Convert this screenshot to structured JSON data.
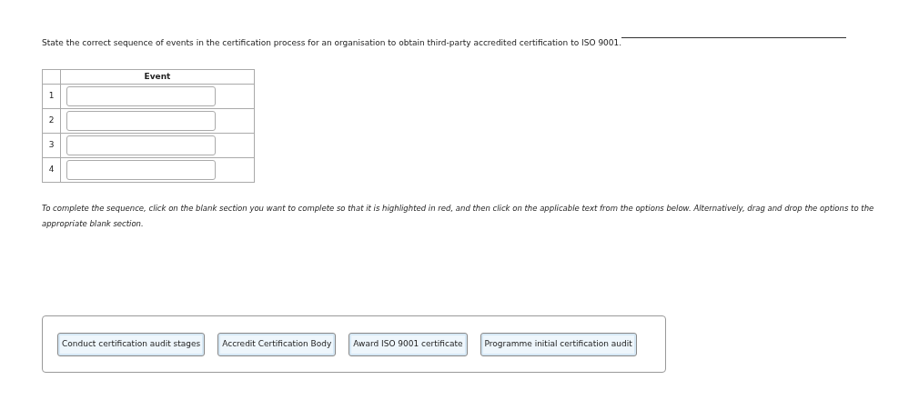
{
  "question": "State the correct sequence of events in the certification process for an organisation to obtain third-party accredited certification to ISO 9001.",
  "table": {
    "columns": [
      "Event"
    ],
    "rows": [
      {
        "number": "1"
      },
      {
        "number": "2"
      },
      {
        "number": "3"
      },
      {
        "number": "4"
      }
    ]
  },
  "instructions": "To complete the sequence, click on the blank section you want to complete so that it is highlighted in red, and then click on the applicable text from the options below. Alternatively, drag and drop the options to the appropriate blank section.",
  "options": [
    "Conduct certification audit stages",
    "Accredit Certification Body",
    "Award ISO 9001 certificate",
    "Programme initial certification audit"
  ]
}
